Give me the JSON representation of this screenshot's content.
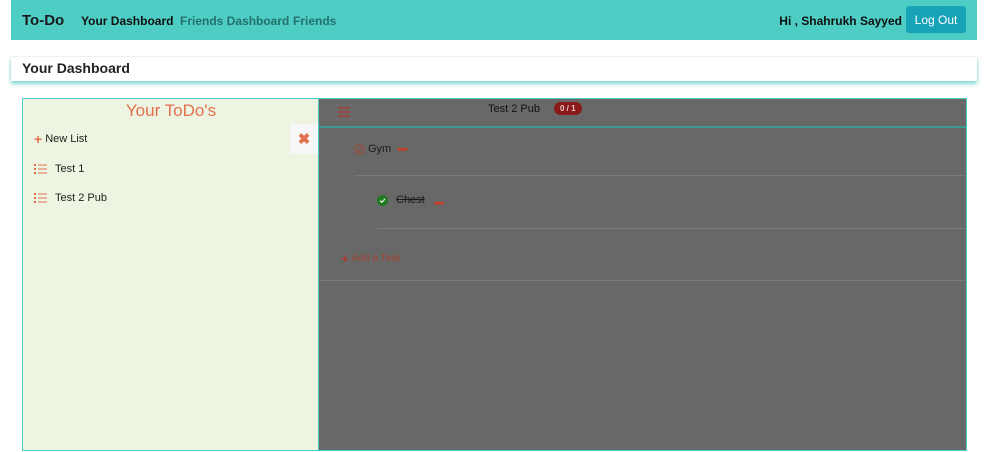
{
  "navbar": {
    "brand": "To-Do",
    "links": [
      "Your Dashboard",
      "Friends Dashboard",
      "Friends"
    ],
    "greeting": "Hi , Shahrukh Sayyed",
    "logout_label": "Log Out"
  },
  "dashboard": {
    "title": "Your Dashboard"
  },
  "sidebar": {
    "title": "Your ToDo's",
    "close_glyph": "✖",
    "new_list_label": "New List",
    "lists": [
      "Test 1",
      "Test 2 Pub"
    ]
  },
  "main": {
    "list_name": "Test 2 Pub",
    "count_badge": "0 / 1",
    "tasks": [
      {
        "label": "Gym",
        "done": false,
        "menu": "•••"
      },
      {
        "label": "Chest",
        "done": true,
        "menu": "•••"
      }
    ],
    "add_task_label": "Add a Task"
  },
  "colors": {
    "navbar": "#4ecdc4",
    "accent": "#e2704d",
    "sidebar_bg": "#eef4e2",
    "overlay": "#686868",
    "logout": "#17a2b8",
    "badge": "#8b1a1a",
    "done_check": "#1e7a1e"
  }
}
